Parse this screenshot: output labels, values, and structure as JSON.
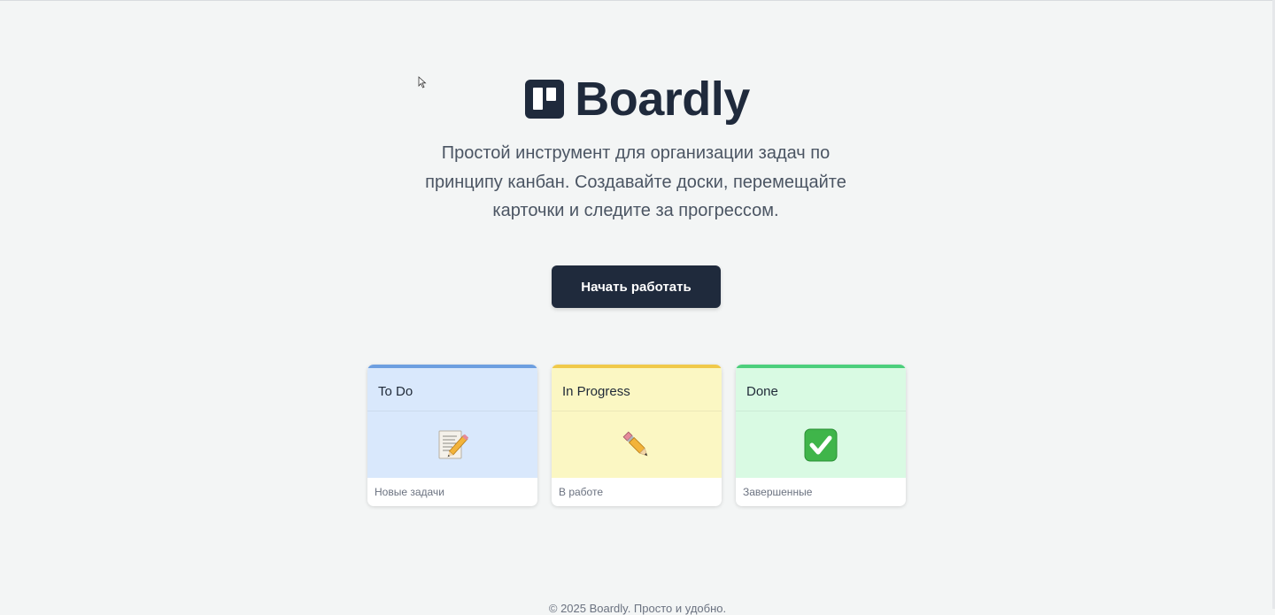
{
  "brand": {
    "name": "Boardly",
    "icon": "board-logo-icon"
  },
  "tagline": "Простой инструмент для организации задач по принципу канбан. Создавайте доски, перемещайте карточки и следите за прогрессом.",
  "cta_label": "Начать работать",
  "columns": [
    {
      "title": "To Do",
      "icon": "memo-icon",
      "caption": "Новые задачи",
      "accent": "#6d9fe0",
      "bg": "#d9e8fc"
    },
    {
      "title": "In Progress",
      "icon": "pencil-icon",
      "caption": "В работе",
      "accent": "#f0c94a",
      "bg": "#fbf7c3"
    },
    {
      "title": "Done",
      "icon": "check-mark-icon",
      "caption": "Завершенные",
      "accent": "#4ccf7c",
      "bg": "#d9fae3"
    }
  ],
  "footer": "© 2025 Boardly. Просто и удобно.",
  "colors": {
    "page_bg": "#f3f5f5",
    "brand_dark": "#1f2a3c",
    "text_muted": "#4b5563"
  }
}
